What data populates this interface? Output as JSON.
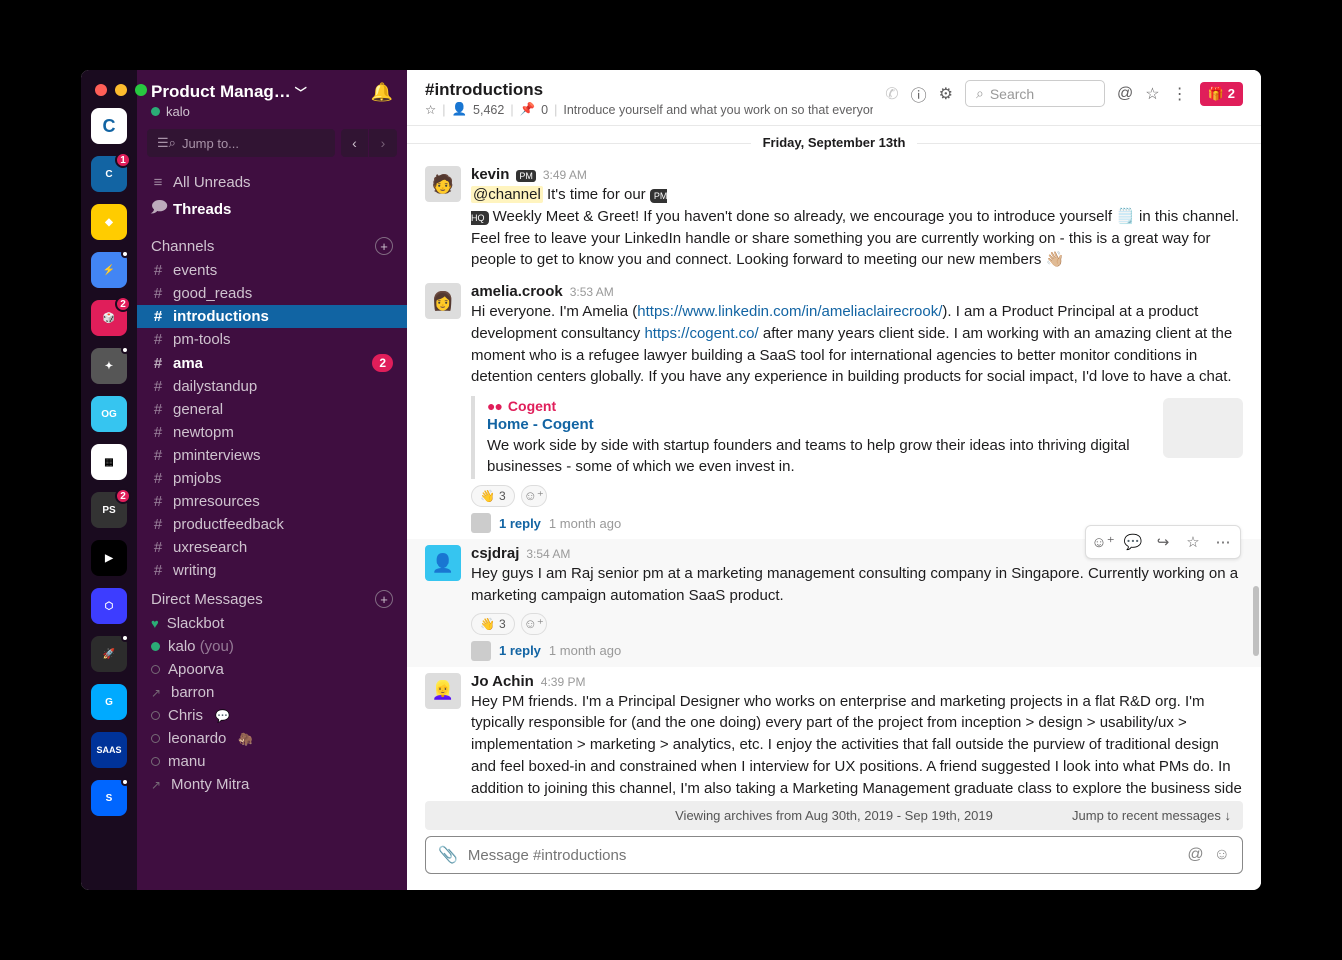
{
  "workspace": {
    "name": "Product Manag…",
    "user": "kalo"
  },
  "jump_placeholder": "Jump to...",
  "nav": {
    "all_unreads": "All Unreads",
    "threads": "Threads"
  },
  "sections": {
    "channels_title": "Channels",
    "dm_title": "Direct Messages"
  },
  "channels": [
    {
      "name": "events"
    },
    {
      "name": "good_reads"
    },
    {
      "name": "introductions",
      "active": true,
      "bold": true
    },
    {
      "name": "pm-tools"
    },
    {
      "name": "ama",
      "badge": "2",
      "bold": true
    },
    {
      "name": "dailystandup"
    },
    {
      "name": "general"
    },
    {
      "name": "newtopm"
    },
    {
      "name": "pminterviews"
    },
    {
      "name": "pmjobs"
    },
    {
      "name": "pmresources"
    },
    {
      "name": "productfeedback"
    },
    {
      "name": "uxresearch"
    },
    {
      "name": "writing"
    }
  ],
  "dms": [
    {
      "name": "Slackbot",
      "status": "heart"
    },
    {
      "name": "kalo",
      "suffix": "(you)",
      "status": "online"
    },
    {
      "name": "Apoorva",
      "status": "offline"
    },
    {
      "name": "barron",
      "status": "offline",
      "away": true
    },
    {
      "name": "Chris",
      "status": "offline",
      "emoji": "💬"
    },
    {
      "name": "leonardo",
      "status": "offline",
      "emoji": "🦣"
    },
    {
      "name": "manu",
      "status": "offline"
    },
    {
      "name": "Monty Mitra",
      "status": "offline",
      "away": true
    }
  ],
  "header": {
    "channel": "#introductions",
    "members": "5,462",
    "pins": "0",
    "topic": "Introduce yourself and what you work on so that everyone can ge…",
    "search_placeholder": "Search",
    "gift_count": "2"
  },
  "date_divider": "Friday, September 13th",
  "messages": {
    "m1": {
      "author": "kevin",
      "time": "3:49 AM",
      "prefix": "@channel",
      "text_a": " It's time for our ",
      "text_b": " Weekly Meet & Greet! If you haven't done so already, we encourage you to introduce yourself ",
      "text_c": " in this channel. Feel free to leave your LinkedIn handle or share something you are currently working on - this is a great way for people to get to know you and connect. Looking forward to meeting our new members 👋🏼"
    },
    "m2": {
      "author": "amelia.crook",
      "time": "3:53 AM",
      "t1": "Hi everyone. I'm Amelia (",
      "link1": "https://www.linkedin.com/in/ameliaclairecrook/",
      "t2": "). I am a Product Principal at a product development consultancy ",
      "link2": "https://cogent.co/",
      "t3": " after many years client side. I am working with an amazing client at the moment who is a refugee lawyer building a SaaS tool for international agencies to better monitor conditions in detention centers globally. If you have any experience in building products for social impact, I'd love to have a chat.",
      "preview": {
        "site": "Cogent",
        "title": "Home - Cogent",
        "desc": "We work side by side with startup founders and teams to help grow their ideas into thriving digital businesses - some of which we even invest in."
      },
      "reaction_count": "3",
      "reply": "1 reply",
      "reply_time": "1 month ago"
    },
    "m3": {
      "author": "csjdraj",
      "time": "3:54 AM",
      "text": "Hey guys I am Raj senior pm at a marketing management  consulting company in Singapore. Currently working on a marketing campaign automation  SaaS product.",
      "reaction_count": "3",
      "reply": "1 reply",
      "reply_time": "1 month ago"
    },
    "m4": {
      "author": "Jo Achin",
      "time": "4:39 PM",
      "text": "Hey PM friends. I'm a Principal Designer who works on enterprise and marketing projects in a flat R&D org. I'm typically responsible for (and the one doing) every part of the project from inception > design > usability/ux > implementation > marketing > analytics, etc. I enjoy the activities that fall outside the purview of traditional design and feel boxed-in and constrained when I interview for UX positions. A friend suggested I look into what PMs do. In addition to joining this channel, I'm also taking a Marketing Management graduate class to explore the business side of things. If anyone has a similar career story, please feel free to reach out. Things feel a bit muddled these days. Looking forward to learning from you!"
    }
  },
  "archive": {
    "text": "Viewing archives from Aug 30th, 2019 - Sep 19th, 2019",
    "jump": "Jump to recent messages  ↓"
  },
  "composer_placeholder": "Message #introductions"
}
